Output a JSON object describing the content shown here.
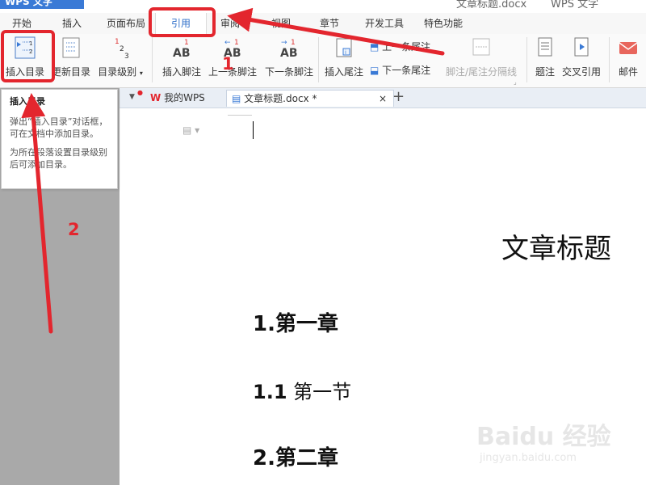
{
  "window": {
    "app_logo": "WPS 文字",
    "doc_title": "文章标题.docx",
    "app_name": "WPS 文字"
  },
  "menu": {
    "tabs": [
      "开始",
      "插入",
      "页面布局",
      "引用",
      "审阅",
      "视图",
      "章节",
      "开发工具",
      "特色功能"
    ],
    "active": "引用"
  },
  "ribbon": {
    "insert_toc": "插入目录",
    "update_toc": "更新目录",
    "toc_level": "目录级别",
    "insert_footnote": "插入脚注",
    "prev_footnote": "上一条脚注",
    "next_footnote": "下一条脚注",
    "insert_endnote": "插入尾注",
    "prev_endnote": "上一条尾注",
    "next_endnote": "下一条尾注",
    "footnote_separator": "脚注/尾注分隔线",
    "caption": "题注",
    "cross_reference": "交叉引用",
    "mail": "邮件"
  },
  "tabs": {
    "wps_home": "我的WPS",
    "doc_tab": "文章标题.docx *",
    "close": "×",
    "add": "+"
  },
  "tooltip": {
    "title": "插入目录",
    "line1": "弹出“插入目录”对话框，可在文档中添加目录。",
    "line2": "为所在段落设置目录级别后可添加目录。"
  },
  "document": {
    "title": "文章标题",
    "heading1": "1.第一章",
    "heading2_num": "1.1",
    "heading2_text": "第一节",
    "heading3": "2.第二章"
  },
  "annotations": {
    "step1": "1",
    "step2": "2",
    "color": "#e3262e"
  },
  "watermark": {
    "brand": "Baidu 经验",
    "url": "jingyan.baidu.com"
  }
}
